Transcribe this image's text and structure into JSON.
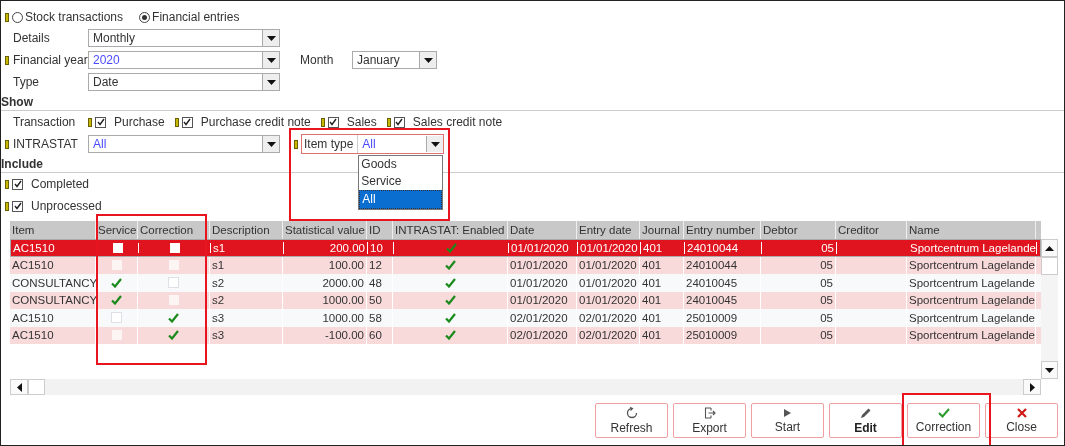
{
  "source": {
    "required": true,
    "options": [
      {
        "label": "Stock transactions",
        "selected": false
      },
      {
        "label": "Financial entries",
        "selected": true
      }
    ]
  },
  "details": {
    "label": "Details",
    "value": "Monthly",
    "required": false,
    "emphasized": false
  },
  "financial_year": {
    "label": "Financial year",
    "value": "2020",
    "required": true,
    "emphasized": true
  },
  "month": {
    "label": "Month",
    "value": "January"
  },
  "type": {
    "label": "Type",
    "value": "Date",
    "required": false,
    "emphasized": false
  },
  "show": {
    "title": "Show",
    "transaction_label": "Transaction",
    "transactions": [
      {
        "label": "Purchase",
        "checked": true,
        "required": true
      },
      {
        "label": "Purchase credit note",
        "checked": true,
        "required": true
      },
      {
        "label": "Sales",
        "checked": true,
        "required": true
      },
      {
        "label": "Sales credit note",
        "checked": true,
        "required": true
      }
    ],
    "intrastat": {
      "label": "INTRASTAT",
      "value": "All",
      "required": true,
      "emphasized": true
    },
    "item_type": {
      "label": "Item type",
      "value": "All",
      "required": true,
      "emphasized": true,
      "expanded": true,
      "options": [
        {
          "label": "Goods",
          "selected": false
        },
        {
          "label": "Service",
          "selected": false
        },
        {
          "label": "All",
          "selected": true
        }
      ]
    }
  },
  "include": {
    "title": "Include",
    "items": [
      {
        "label": "Completed",
        "checked": true,
        "required": true
      },
      {
        "label": "Unprocessed",
        "checked": true,
        "required": true
      }
    ]
  },
  "table": {
    "columns": [
      "Item",
      "Service",
      "Correction",
      "Description",
      "Statistical value",
      "ID",
      "INTRASTAT: Enabled",
      "Date",
      "Entry date",
      "Journal",
      "Entry number",
      "Debtor",
      "Creditor",
      "Name"
    ],
    "rows": [
      {
        "selected": true,
        "item": "AC1510",
        "service": false,
        "correction": false,
        "description": "s1",
        "statistical_value": "200.00",
        "id": "10",
        "intrastat_enabled": true,
        "date": "01/01/2020",
        "entry_date": "01/01/2020",
        "journal": "401",
        "entry_number": "24010044",
        "debtor": "05",
        "name": "Sportcentrum Lagelande"
      },
      {
        "selected": false,
        "item": "AC1510",
        "service": false,
        "correction": false,
        "description": "s1",
        "statistical_value": "100.00",
        "id": "12",
        "intrastat_enabled": true,
        "date": "01/01/2020",
        "entry_date": "01/01/2020",
        "journal": "401",
        "entry_number": "24010044",
        "debtor": "05",
        "name": "Sportcentrum Lagelande"
      },
      {
        "selected": false,
        "item": "CONSULTANCY",
        "service": true,
        "correction": false,
        "description": "s2",
        "statistical_value": "2000.00",
        "id": "48",
        "intrastat_enabled": true,
        "date": "01/01/2020",
        "entry_date": "01/01/2020",
        "journal": "401",
        "entry_number": "24010045",
        "debtor": "05",
        "name": "Sportcentrum Lagelande"
      },
      {
        "selected": false,
        "item": "CONSULTANCY",
        "service": true,
        "correction": false,
        "description": "s2",
        "statistical_value": "1000.00",
        "id": "50",
        "intrastat_enabled": true,
        "date": "01/01/2020",
        "entry_date": "01/01/2020",
        "journal": "401",
        "entry_number": "24010045",
        "debtor": "05",
        "name": "Sportcentrum Lagelande"
      },
      {
        "selected": false,
        "item": "AC1510",
        "service": false,
        "correction": true,
        "description": "s3",
        "statistical_value": "1000.00",
        "id": "58",
        "intrastat_enabled": true,
        "date": "02/01/2020",
        "entry_date": "02/01/2020",
        "journal": "401",
        "entry_number": "25010009",
        "debtor": "05",
        "name": "Sportcentrum Lagelande"
      },
      {
        "selected": false,
        "item": "AC1510",
        "service": false,
        "correction": true,
        "description": "s3",
        "statistical_value": "-100.00",
        "id": "60",
        "intrastat_enabled": true,
        "date": "02/01/2020",
        "entry_date": "02/01/2020",
        "journal": "401",
        "entry_number": "25010009",
        "debtor": "05",
        "name": "Sportcentrum Lagelande"
      }
    ]
  },
  "buttons": [
    {
      "label": "Refresh",
      "kind": "refresh",
      "bold": false
    },
    {
      "label": "Export",
      "kind": "export",
      "bold": false
    },
    {
      "label": "Start",
      "kind": "start",
      "bold": false
    },
    {
      "label": "Edit",
      "kind": "edit",
      "bold": true
    },
    {
      "label": "Correction",
      "kind": "check",
      "bold": false
    },
    {
      "label": "Close",
      "kind": "close",
      "bold": false
    }
  ]
}
